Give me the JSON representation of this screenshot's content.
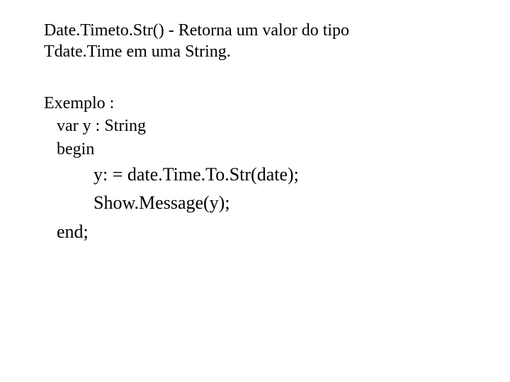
{
  "intro": {
    "line1": "Date.Timeto.Str() - Retorna um valor do tipo",
    "line2": "Tdate.Time em uma String."
  },
  "example": {
    "heading": "Exemplo :",
    "var_decl": "var y : String",
    "begin": "begin",
    "assign": "y: = date.Time.To.Str(date);",
    "showmsg": "Show.Message(y);",
    "end": "end;"
  }
}
